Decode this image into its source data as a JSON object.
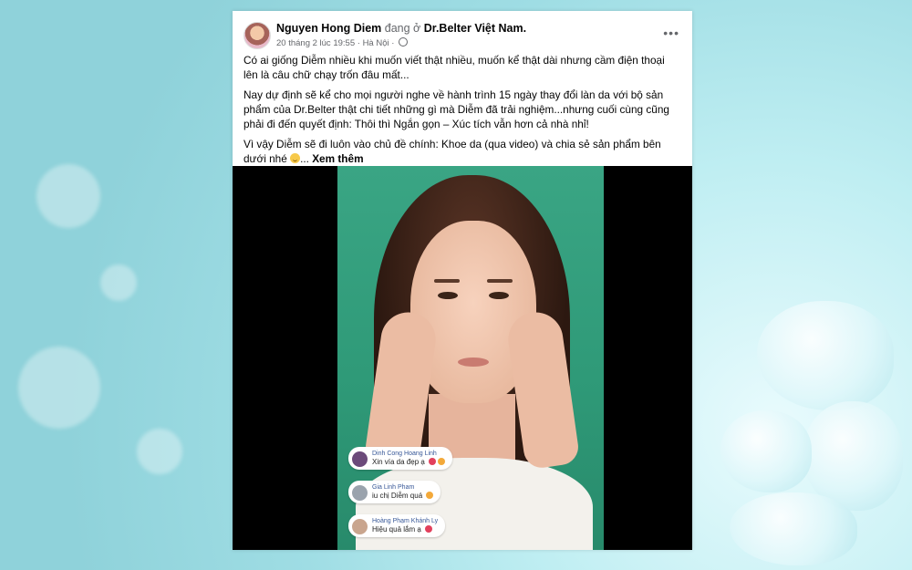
{
  "post": {
    "author": "Nguyen Hong Diem",
    "verb": "đang ở",
    "page": "Dr.Belter Việt Nam.",
    "timestamp": "20 tháng 2 lúc 19:55",
    "location": "Hà Nội",
    "paragraphs": [
      "Có ai giống Diễm nhiều khi muốn viết thật nhiều, muốn kể thật dài nhưng cầm điện thoại lên là câu chữ chạy trốn đâu mất...",
      "Nay dự định sẽ kể cho mọi người nghe về hành trình 15 ngày thay đổi làn da với bộ sản phẩm của Dr.Belter thật chi tiết những gì mà Diễm đã trải nghiệm...nhưng cuối cùng cũng phải đi đến quyết định: Thôi thì Ngắn gọn – Xúc tích vẫn hơn cả nhà nhỉ!",
      "Vì vậy Diễm sẽ đi luôn vào chủ đề chính: Khoe da (qua video) và chia sẻ sản phẩm bên dưới nhé"
    ],
    "ellipsis": "...",
    "see_more": "Xem thêm"
  },
  "video_comments": [
    {
      "name": "Dinh Cong Hoang Linh",
      "text": "Xin vía da đẹp ạ",
      "icon": "heart-eyes-icon",
      "avatar_color": "#6b4a7a"
    },
    {
      "name": "Gia Linh Pham",
      "text": "iu chị Diễm quá",
      "icon": "hug-icon",
      "avatar_color": "#9aa3ad"
    },
    {
      "name": "Hoàng Phạm Khánh Ly",
      "text": "Hiệu quả lắm ạ",
      "icon": "heart-icon",
      "avatar_color": "#c9a58e"
    }
  ],
  "colors": {
    "link": "#385898",
    "video_background": "#2f9a78",
    "secondary_text": "#65676b"
  }
}
